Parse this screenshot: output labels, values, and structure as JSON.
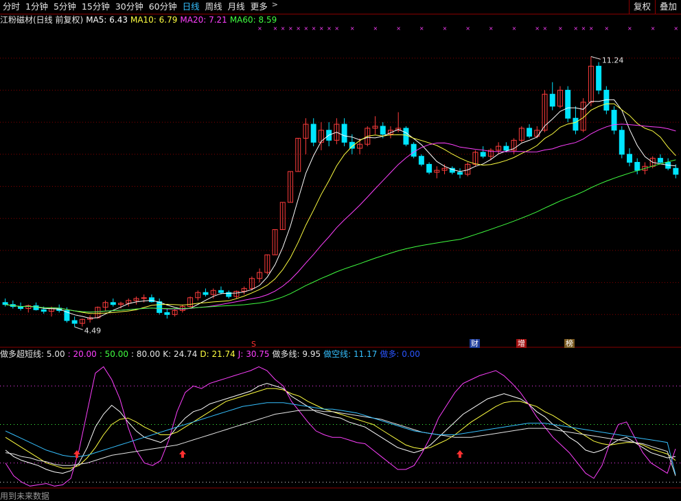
{
  "toolbar": {
    "periods": [
      "分时",
      "1分钟",
      "5分钟",
      "15分钟",
      "30分钟",
      "60分钟",
      "日线",
      "周线",
      "月线",
      "更多"
    ],
    "active": "日线",
    "more_arrow": ">",
    "btn_restore": "复权",
    "btn_overlay": "叠加"
  },
  "main_legend": {
    "title": "江粉磁材(日线 前复权)",
    "ma5": "MA5: 6.43",
    "ma10": "MA10: 6.79",
    "ma20": "MA20: 7.21",
    "ma60": "MA60: 8.59",
    "colors": {
      "title": "#e6e6e6",
      "ma5": "#ffffff",
      "ma10": "#ffff40",
      "ma20": "#ff40ff",
      "ma60": "#40ff40"
    }
  },
  "annotations": {
    "high_label": "11.24",
    "low_label": "4.49",
    "event_s": "S",
    "event_cai": "财",
    "event_zeng": "增",
    "event_bang": "榜"
  },
  "indicator_legend": {
    "name": "做多超短线",
    "p1": ": 5.00",
    "p2": ": 20.00",
    "p3": ": 50.00",
    "p4": ": 80.00",
    "k": "K: 24.74",
    "d": "D: 21.74",
    "j": "J: 30.75",
    "long": "做多线: 9.95",
    "short": "做空线: 11.17",
    "signal": "做多: 0.00"
  },
  "hint": "用到未来数据",
  "colors": {
    "up": "#ff3c3c",
    "down": "#00e5ff",
    "bg": "#000000",
    "grid": "#8a0000"
  },
  "chart_data": [
    {
      "type": "candlestick",
      "title": "江粉磁材(日线 前复权)",
      "ylim": [
        4.0,
        12.0
      ],
      "highest": 11.24,
      "lowest": 4.49,
      "candles": [
        [
          5.1,
          5.2,
          5.0,
          5.05
        ],
        [
          5.05,
          5.15,
          4.95,
          5.0
        ],
        [
          5.0,
          5.1,
          4.9,
          4.95
        ],
        [
          4.95,
          5.05,
          4.85,
          5.02
        ],
        [
          5.02,
          5.1,
          4.9,
          4.92
        ],
        [
          4.92,
          5.0,
          4.82,
          4.88
        ],
        [
          4.88,
          5.0,
          4.75,
          4.96
        ],
        [
          4.96,
          5.05,
          4.85,
          4.9
        ],
        [
          4.9,
          4.98,
          4.6,
          4.65
        ],
        [
          4.65,
          4.75,
          4.49,
          4.58
        ],
        [
          4.58,
          4.7,
          4.5,
          4.68
        ],
        [
          4.68,
          4.78,
          4.6,
          4.72
        ],
        [
          4.72,
          5.0,
          4.7,
          4.98
        ],
        [
          4.98,
          5.15,
          4.9,
          5.1
        ],
        [
          5.1,
          5.2,
          5.0,
          5.05
        ],
        [
          5.05,
          5.12,
          4.95,
          5.08
        ],
        [
          5.08,
          5.2,
          5.0,
          5.15
        ],
        [
          5.15,
          5.25,
          5.05,
          5.2
        ],
        [
          5.2,
          5.3,
          5.1,
          5.22
        ],
        [
          5.22,
          5.3,
          5.1,
          5.12
        ],
        [
          5.12,
          5.2,
          4.8,
          4.85
        ],
        [
          4.85,
          4.95,
          4.7,
          4.8
        ],
        [
          4.8,
          4.95,
          4.75,
          4.9
        ],
        [
          4.9,
          5.05,
          4.85,
          5.0
        ],
        [
          5.0,
          5.25,
          4.95,
          5.22
        ],
        [
          5.22,
          5.4,
          5.15,
          5.35
        ],
        [
          5.35,
          5.45,
          5.25,
          5.3
        ],
        [
          5.3,
          5.45,
          5.2,
          5.4
        ],
        [
          5.4,
          5.5,
          5.3,
          5.35
        ],
        [
          5.35,
          5.4,
          5.2,
          5.25
        ],
        [
          5.25,
          5.4,
          5.2,
          5.38
        ],
        [
          5.38,
          5.5,
          5.3,
          5.45
        ],
        [
          5.45,
          5.75,
          5.4,
          5.7
        ],
        [
          5.7,
          5.95,
          5.6,
          5.85
        ],
        [
          5.85,
          6.3,
          5.8,
          6.29
        ],
        [
          6.29,
          6.92,
          6.29,
          6.92
        ],
        [
          6.92,
          7.6,
          6.92,
          7.6
        ],
        [
          7.6,
          8.37,
          7.6,
          8.37
        ],
        [
          8.37,
          9.2,
          8.37,
          9.2
        ],
        [
          9.2,
          9.7,
          8.8,
          9.55
        ],
        [
          9.55,
          9.7,
          9.0,
          9.1
        ],
        [
          9.1,
          9.6,
          8.9,
          9.4
        ],
        [
          9.4,
          9.6,
          9.0,
          9.15
        ],
        [
          9.15,
          9.7,
          9.05,
          9.55
        ],
        [
          9.55,
          9.7,
          9.0,
          9.1
        ],
        [
          9.1,
          9.3,
          8.8,
          8.95
        ],
        [
          8.95,
          9.2,
          8.8,
          9.05
        ],
        [
          9.05,
          9.5,
          9.0,
          9.45
        ],
        [
          9.45,
          9.75,
          9.3,
          9.5
        ],
        [
          9.5,
          9.6,
          9.2,
          9.3
        ],
        [
          9.3,
          9.5,
          9.2,
          9.4
        ],
        [
          9.4,
          9.85,
          9.35,
          9.45
        ],
        [
          9.45,
          9.5,
          9.0,
          9.05
        ],
        [
          9.05,
          9.1,
          8.7,
          8.75
        ],
        [
          8.75,
          8.8,
          8.5,
          8.55
        ],
        [
          8.55,
          8.6,
          8.3,
          8.35
        ],
        [
          8.35,
          8.5,
          8.2,
          8.4
        ],
        [
          8.4,
          8.55,
          8.3,
          8.45
        ],
        [
          8.45,
          8.5,
          8.3,
          8.35
        ],
        [
          8.35,
          8.45,
          8.2,
          8.3
        ],
        [
          8.3,
          8.6,
          8.25,
          8.55
        ],
        [
          8.55,
          8.9,
          8.5,
          8.85
        ],
        [
          8.85,
          9.0,
          8.7,
          8.75
        ],
        [
          8.75,
          8.95,
          8.65,
          8.9
        ],
        [
          8.9,
          9.1,
          8.8,
          9.0
        ],
        [
          9.0,
          9.1,
          8.85,
          8.9
        ],
        [
          8.9,
          9.2,
          8.8,
          9.15
        ],
        [
          9.15,
          9.5,
          9.1,
          9.45
        ],
        [
          9.45,
          9.55,
          9.2,
          9.25
        ],
        [
          9.25,
          9.5,
          9.2,
          9.4
        ],
        [
          9.4,
          10.4,
          9.35,
          10.3
        ],
        [
          10.3,
          10.6,
          9.9,
          10.0
        ],
        [
          10.0,
          10.5,
          9.95,
          10.4
        ],
        [
          10.4,
          10.5,
          9.6,
          9.7
        ],
        [
          9.7,
          10.0,
          9.3,
          9.4
        ],
        [
          9.4,
          10.2,
          9.35,
          10.1
        ],
        [
          10.1,
          11.24,
          10.0,
          11.0
        ],
        [
          11.0,
          11.1,
          10.3,
          10.4
        ],
        [
          10.4,
          10.5,
          9.8,
          9.9
        ],
        [
          9.9,
          10.0,
          9.3,
          9.4
        ],
        [
          9.4,
          9.5,
          8.7,
          8.8
        ],
        [
          8.8,
          8.95,
          8.5,
          8.6
        ],
        [
          8.6,
          8.7,
          8.3,
          8.4
        ],
        [
          8.4,
          8.6,
          8.3,
          8.5
        ],
        [
          8.5,
          8.75,
          8.45,
          8.7
        ],
        [
          8.7,
          8.8,
          8.55,
          8.6
        ],
        [
          8.6,
          8.7,
          8.4,
          8.45
        ],
        [
          8.45,
          8.55,
          8.2,
          8.3
        ]
      ]
    },
    {
      "type": "line",
      "title": "做多超短线",
      "series": [
        {
          "name": "K",
          "values": [
            30,
            25,
            22,
            20,
            18,
            15,
            13,
            12,
            14,
            20,
            32,
            48,
            58,
            65,
            60,
            52,
            45,
            40,
            38,
            36,
            40,
            48,
            55,
            60,
            62,
            66,
            68,
            70,
            72,
            74,
            76,
            80,
            82,
            80,
            78,
            72,
            68,
            64,
            60,
            58,
            56,
            55,
            52,
            50,
            48,
            44,
            40,
            36,
            32,
            30,
            28,
            30,
            34,
            40,
            46,
            52,
            58,
            62,
            66,
            70,
            72,
            74,
            72,
            70,
            66,
            60,
            56,
            50,
            46,
            40,
            36,
            30,
            28,
            30,
            34,
            38,
            40,
            36,
            32,
            28,
            26,
            24,
            25
          ]
        },
        {
          "name": "D",
          "values": [
            40,
            36,
            32,
            28,
            24,
            20,
            18,
            16,
            16,
            18,
            24,
            32,
            42,
            50,
            54,
            55,
            52,
            48,
            45,
            42,
            42,
            44,
            48,
            52,
            56,
            60,
            64,
            68,
            70,
            72,
            74,
            76,
            78,
            78,
            77,
            74,
            72,
            68,
            65,
            62,
            60,
            58,
            56,
            54,
            52,
            50,
            46,
            42,
            38,
            34,
            32,
            31,
            32,
            35,
            38,
            42,
            47,
            52,
            56,
            60,
            64,
            67,
            68,
            68,
            66,
            64,
            60,
            57,
            53,
            49,
            45,
            41,
            37,
            35,
            34,
            35,
            36,
            36,
            34,
            31,
            29,
            27,
            22
          ]
        },
        {
          "name": "J",
          "values": [
            20,
            10,
            5,
            2,
            3,
            4,
            2,
            3,
            8,
            30,
            60,
            90,
            95,
            85,
            70,
            48,
            30,
            20,
            18,
            22,
            38,
            60,
            75,
            80,
            78,
            82,
            84,
            86,
            88,
            90,
            92,
            95,
            92,
            85,
            80,
            68,
            60,
            52,
            45,
            42,
            40,
            40,
            38,
            36,
            35,
            30,
            25,
            20,
            15,
            15,
            18,
            28,
            40,
            55,
            65,
            75,
            82,
            85,
            88,
            90,
            92,
            88,
            82,
            75,
            66,
            56,
            48,
            40,
            34,
            28,
            20,
            12,
            8,
            18,
            36,
            50,
            52,
            40,
            28,
            20,
            16,
            12,
            31
          ]
        },
        {
          "name": "做多线",
          "values": [
            28,
            27,
            25,
            24,
            22,
            21,
            19,
            18,
            18,
            19,
            20,
            22,
            24,
            26,
            27,
            28,
            29,
            30,
            31,
            32,
            33,
            34,
            36,
            38,
            40,
            42,
            44,
            46,
            48,
            50,
            52,
            54,
            56,
            58,
            59,
            60,
            61,
            61,
            61,
            60,
            60,
            59,
            58,
            57,
            56,
            55,
            54,
            52,
            50,
            48,
            46,
            44,
            43,
            42,
            41,
            40,
            40,
            40,
            41,
            42,
            43,
            44,
            45,
            46,
            47,
            47,
            47,
            46,
            45,
            44,
            43,
            42,
            41,
            40,
            39,
            38,
            37,
            36,
            35,
            33,
            31,
            29,
            10
          ]
        },
        {
          "name": "做空线",
          "values": [
            45,
            42,
            39,
            36,
            33,
            30,
            28,
            26,
            25,
            25,
            26,
            28,
            30,
            32,
            34,
            36,
            38,
            40,
            42,
            44,
            46,
            48,
            50,
            52,
            54,
            56,
            58,
            60,
            62,
            64,
            65,
            66,
            67,
            67,
            67,
            66,
            65,
            64,
            63,
            62,
            62,
            61,
            60,
            59,
            57,
            55,
            53,
            51,
            49,
            47,
            45,
            44,
            43,
            42,
            42,
            42,
            43,
            44,
            45,
            46,
            47,
            48,
            49,
            50,
            51,
            51,
            51,
            50,
            49,
            48,
            47,
            46,
            45,
            44,
            43,
            42,
            41,
            40,
            39,
            38,
            37,
            36,
            11
          ]
        }
      ],
      "reference_lines": [
        5,
        20,
        50,
        80
      ]
    }
  ]
}
